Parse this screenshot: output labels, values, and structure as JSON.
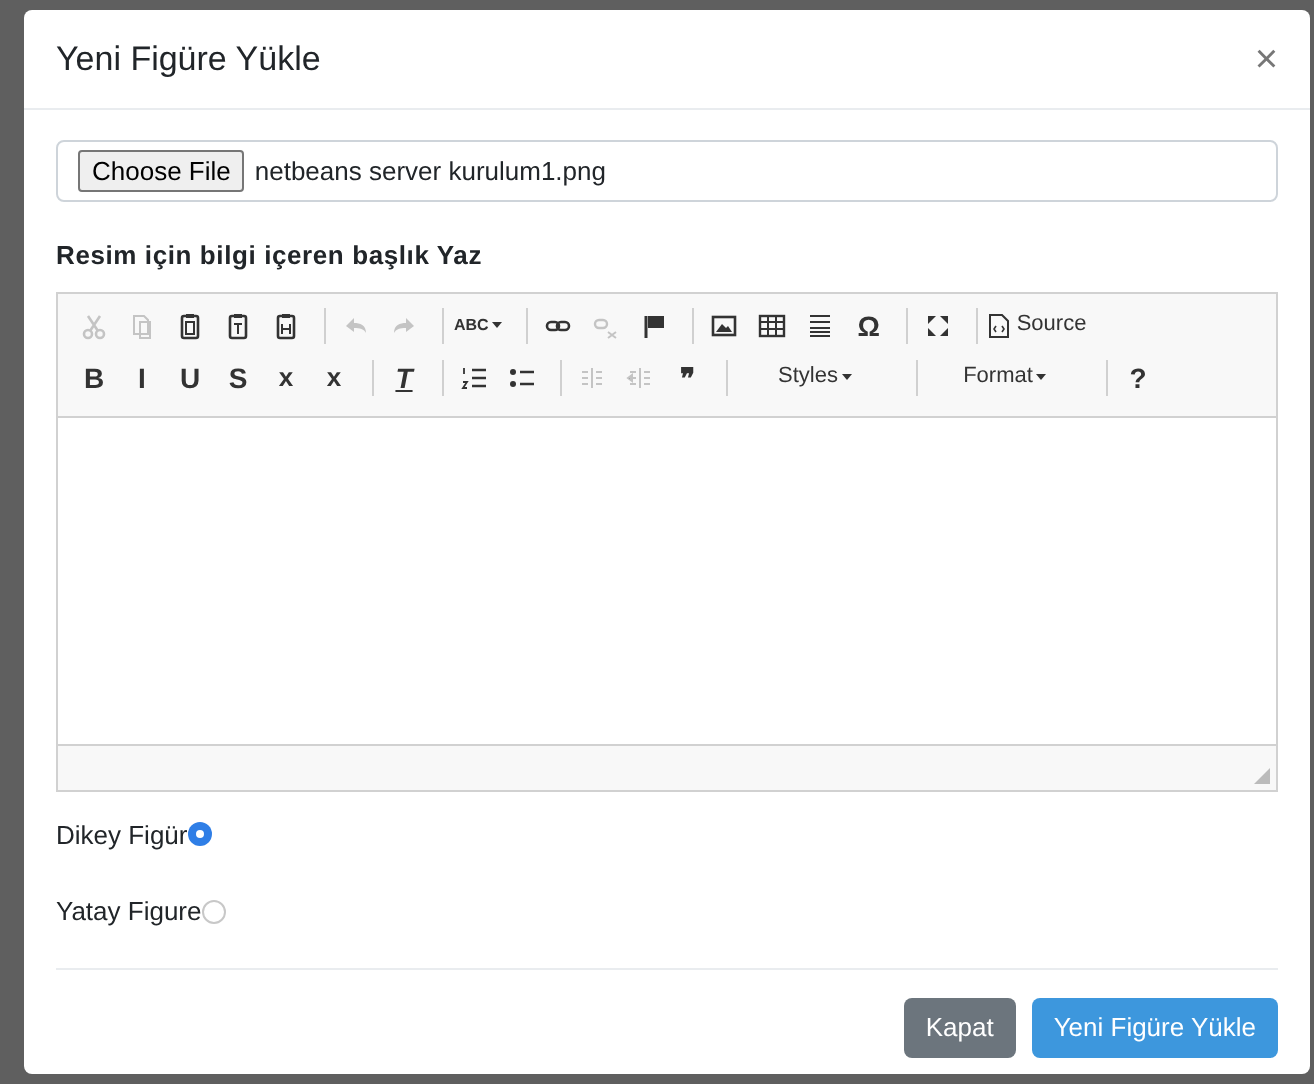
{
  "modal": {
    "title": "Yeni Figüre Yükle",
    "close": "×"
  },
  "file": {
    "button": "Choose File",
    "value": "netbeans server kurulum1.png"
  },
  "caption_label": "Resim için bilgi içeren başlık Yaz",
  "toolbar": [
    [
      {
        "kind": "cut",
        "disabled": true
      },
      {
        "kind": "copy",
        "disabled": true
      },
      {
        "kind": "paste",
        "disabled": false
      },
      {
        "kind": "paste-text",
        "disabled": false
      },
      {
        "kind": "paste-word",
        "disabled": false
      }
    ],
    [
      {
        "kind": "undo",
        "disabled": true
      },
      {
        "kind": "redo",
        "disabled": true
      }
    ],
    [
      {
        "kind": "spell",
        "label": "ABC",
        "disabled": false
      }
    ],
    [
      {
        "kind": "link",
        "disabled": false
      },
      {
        "kind": "unlink",
        "disabled": true
      },
      {
        "kind": "flag",
        "disabled": false
      }
    ],
    [
      {
        "kind": "image",
        "disabled": false
      },
      {
        "kind": "table",
        "disabled": false
      },
      {
        "kind": "hrule",
        "disabled": false
      },
      {
        "kind": "text",
        "label": "Ω",
        "disabled": false
      }
    ],
    [
      {
        "kind": "maximize",
        "disabled": false
      }
    ],
    [
      {
        "kind": "source",
        "label": "Source",
        "disabled": false
      }
    ]
  ],
  "toolbar2": [
    [
      {
        "kind": "text",
        "label": "B",
        "disabled": false
      },
      {
        "kind": "text",
        "label": "I",
        "disabled": false
      },
      {
        "kind": "text",
        "label": "U",
        "disabled": false
      },
      {
        "kind": "text",
        "label": "S",
        "disabled": false
      },
      {
        "kind": "sub",
        "label": "x",
        "disabled": false
      },
      {
        "kind": "sup",
        "label": "x",
        "disabled": false
      }
    ],
    [
      {
        "kind": "clear",
        "label": "T",
        "disabled": false
      }
    ],
    [
      {
        "kind": "ol",
        "disabled": false
      },
      {
        "kind": "ul",
        "disabled": false
      }
    ],
    [
      {
        "kind": "outdent",
        "disabled": true
      },
      {
        "kind": "indent",
        "disabled": true
      },
      {
        "kind": "text",
        "label": "❞",
        "disabled": false
      }
    ],
    [
      {
        "kind": "combo",
        "label": "Styles",
        "disabled": false
      }
    ],
    [
      {
        "kind": "combo",
        "label": "Format",
        "disabled": false
      }
    ],
    [
      {
        "kind": "text",
        "label": "?",
        "disabled": false
      }
    ]
  ],
  "orientation": [
    {
      "label": "Dikey Figür",
      "selected": true
    },
    {
      "label": "Yatay Figure",
      "selected": false
    }
  ],
  "buttons": [
    {
      "kind": "secondary",
      "label": "Kapat"
    },
    {
      "kind": "primary",
      "label": "Yeni Figüre Yükle"
    }
  ]
}
